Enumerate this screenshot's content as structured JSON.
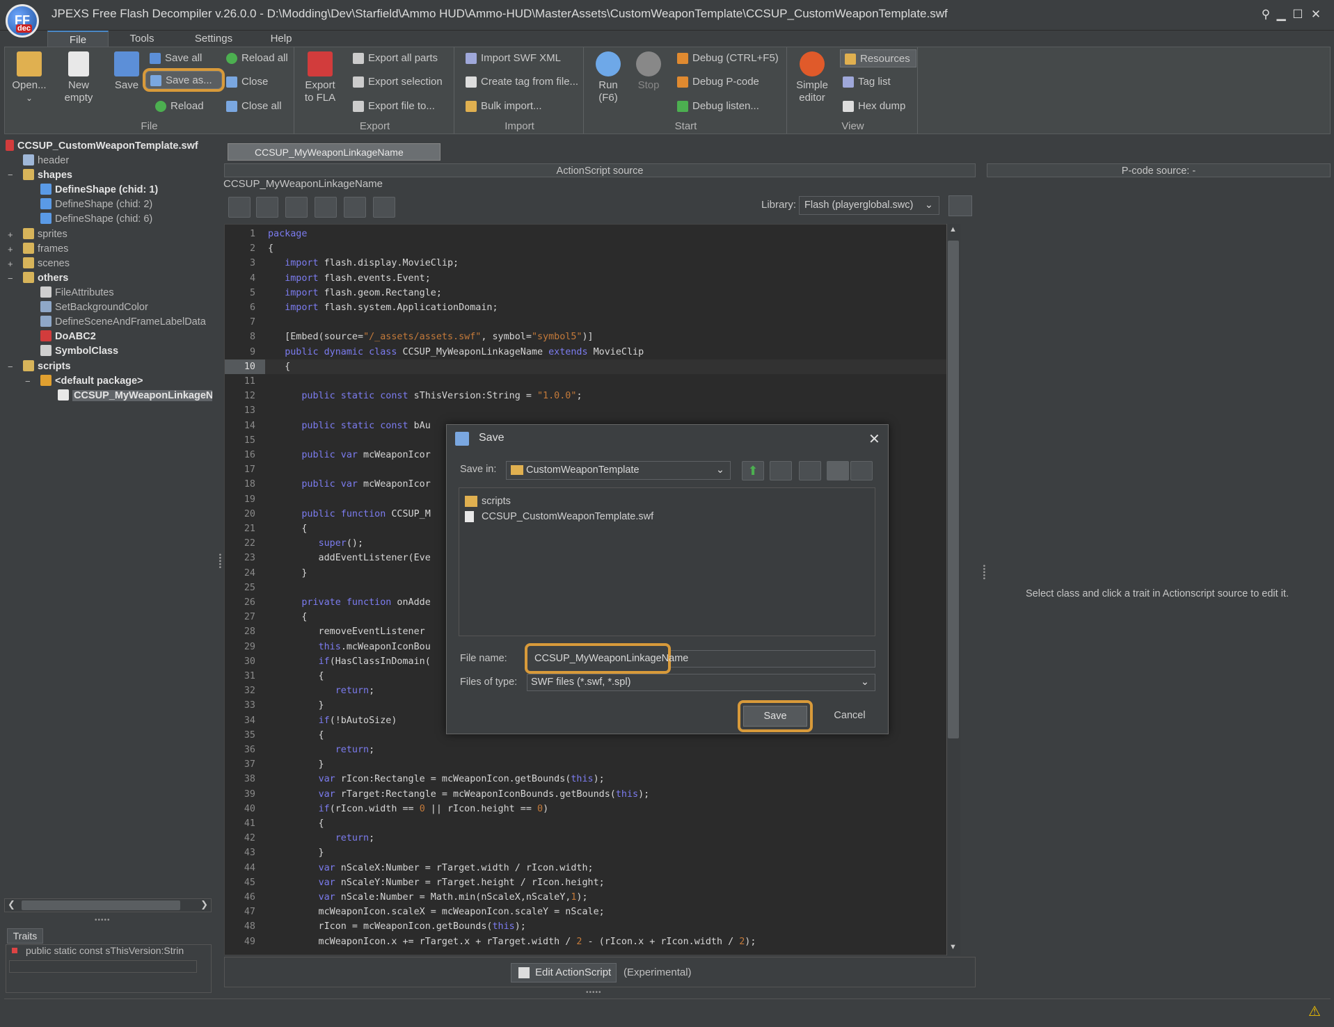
{
  "window": {
    "title": "JPEXS Free Flash Decompiler v.26.0.0 - D:\\Modding\\Dev\\Starfield\\Ammo HUD\\Ammo-HUD\\MasterAssets\\CustomWeaponTemplate\\CCSUP_CustomWeaponTemplate.swf",
    "logo_text": "FF",
    "logo_sub": "dec",
    "controls": {
      "pin": "⚲",
      "minimize": "▁",
      "maximize": "☐",
      "close": "✕"
    }
  },
  "menu": [
    "File",
    "Tools",
    "Settings",
    "Help"
  ],
  "ribbon": {
    "file": {
      "label": "File",
      "open": "Open...",
      "new_empty_1": "New",
      "new_empty_2": "empty",
      "save": "Save",
      "save_all": "Save all",
      "save_as": "Save as...",
      "reload": "Reload",
      "reload_all": "Reload all",
      "close": "Close",
      "close_all": "Close all"
    },
    "export": {
      "label": "Export",
      "export_fla_1": "Export",
      "export_fla_2": "to FLA",
      "export_all_parts": "Export all parts",
      "export_selection": "Export selection",
      "export_file_to": "Export file to..."
    },
    "import": {
      "label": "Import",
      "import_swf_xml": "Import SWF XML",
      "create_tag": "Create tag from file...",
      "bulk_import": "Bulk import..."
    },
    "start": {
      "label": "Start",
      "run_1": "Run",
      "run_2": "(F6)",
      "stop": "Stop",
      "debug": "Debug (CTRL+F5)",
      "debug_pcode": "Debug P-code",
      "debug_listen": "Debug listen..."
    },
    "view": {
      "label": "View",
      "simple_editor_1": "Simple",
      "simple_editor_2": "editor",
      "resources": "Resources",
      "tag_list": "Tag list",
      "hex_dump": "Hex dump"
    }
  },
  "tree": {
    "root": "CCSUP_CustomWeaponTemplate.swf",
    "header": "header",
    "shapes": "shapes",
    "shape1": "DefineShape (chid: 1)",
    "shape2": "DefineShape (chid: 2)",
    "shape6": "DefineShape (chid: 6)",
    "sprites": "sprites",
    "frames": "frames",
    "scenes": "scenes",
    "others": "others",
    "file_attributes": "FileAttributes",
    "set_bg": "SetBackgroundColor",
    "define_scene": "DefineSceneAndFrameLabelData",
    "doabc2": "DoABC2",
    "symbol_class": "SymbolClass",
    "scripts": "scripts",
    "default_package": "<default package>",
    "class_item": "CCSUP_MyWeaponLinkageName"
  },
  "traits": {
    "tab": "Traits",
    "item": "public static const sThisVersion:Strin"
  },
  "editor": {
    "tab": "CCSUP_MyWeaponLinkageName",
    "as_header": "ActionScript source",
    "pcode_header": "P-code source: -",
    "class_label": "CCSUP_MyWeaponLinkageName",
    "library_label": "Library:",
    "library_value": "Flash (playerglobal.swc)",
    "edit_button": "Edit ActionScript",
    "experimental": "(Experimental)",
    "pcode_message": "Select class and click a trait in Actionscript source to edit it.",
    "current_line": 10
  },
  "dialog": {
    "title": "Save",
    "save_in_label": "Save in:",
    "save_in_value": "CustomWeaponTemplate",
    "files": [
      "scripts",
      "CCSUP_CustomWeaponTemplate.swf"
    ],
    "file_name_label": "File name:",
    "file_name_value": "CCSUP_MyWeaponLinkageName",
    "files_of_type_label": "Files of type:",
    "files_of_type_value": "SWF files (*.swf, *.spl)",
    "save_button": "Save",
    "cancel_button": "Cancel"
  },
  "colors": {
    "highlight": "#d89a3a",
    "keyword": "#7c7cf0",
    "string": "#c47a3a",
    "background": "#3c3f41"
  }
}
